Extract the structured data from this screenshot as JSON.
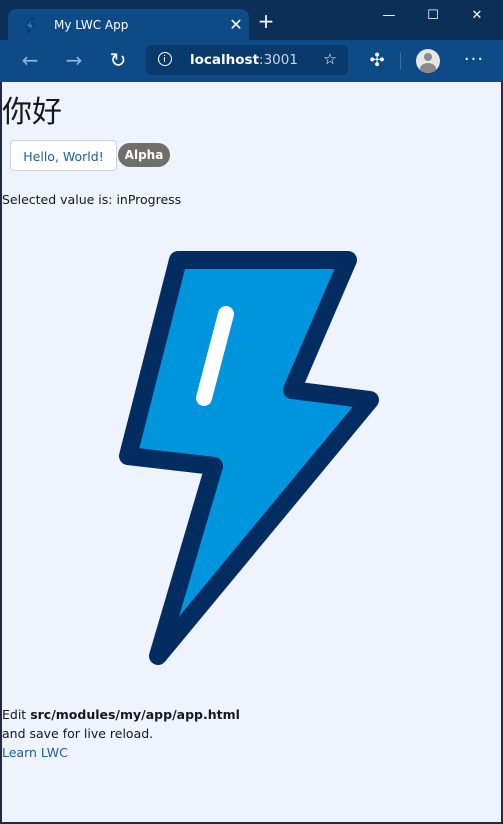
{
  "browser": {
    "tab": {
      "title": "My LWC App",
      "favicon": "lightning-icon"
    },
    "window_controls": {
      "minimize": "—",
      "maximize": "☐",
      "close": "✕"
    },
    "address": {
      "host": "localhost",
      "port": ":3001"
    },
    "new_tab_label": "+"
  },
  "page": {
    "greeting": "你好",
    "hello_button_label": "Hello, World!",
    "badge_label": "Alpha",
    "selected_text": "Selected value is: inProgress",
    "edit_prefix": "Edit ",
    "edit_file": "src/modules/my/app/app.html",
    "save_text": "and save for live reload.",
    "learn_link": "Learn LWC"
  },
  "colors": {
    "brand_blue": "#0d4a86",
    "bolt_fill": "#0095dd",
    "bolt_outline": "#032d60",
    "page_bg": "#eef3fe"
  }
}
